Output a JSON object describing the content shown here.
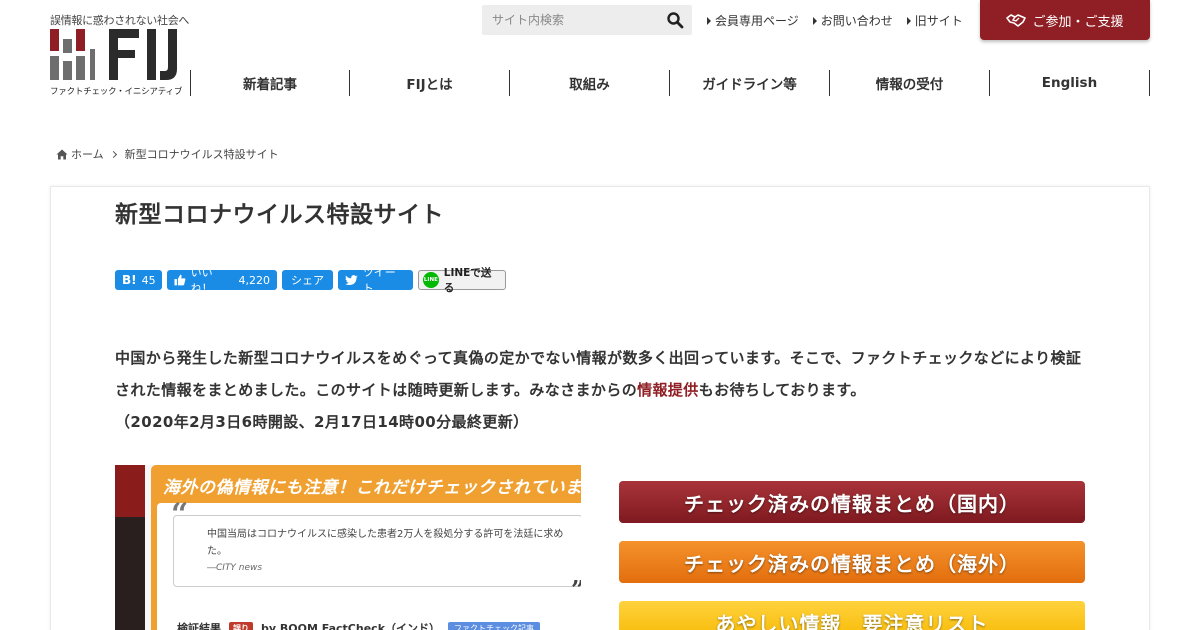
{
  "header": {
    "tagline": "誤情報に惑わされない社会へ",
    "logo_text": "FIJ",
    "logo_caption": "ファクトチェック・イニシアティブ",
    "search": {
      "placeholder": "サイト内検索"
    },
    "top_links": [
      "会員専用ページ",
      "お問い合わせ",
      "旧サイト"
    ],
    "support_label": "ご参加・ご支援",
    "nav": [
      "新着記事",
      "FIJとは",
      "取組み",
      "ガイドライン等",
      "情報の受付",
      "English"
    ],
    "colors": {
      "brand": "#8f1f25",
      "logo_gray": "#6e6e6e"
    }
  },
  "breadcrumb": {
    "home": "ホーム",
    "current": "新型コロナウイルス特設サイト"
  },
  "page": {
    "title": "新型コロナウイルス特設サイト",
    "share": {
      "hatena_label": "B!",
      "hatena_count": "45",
      "fb_like_label": "いいね！",
      "fb_like_count": "4,220",
      "fb_share_label": "シェア",
      "tweet_label": "ツイート",
      "line_label": "LINEで送る",
      "line_icon_text": "LINE"
    },
    "intro": {
      "part1": "中国から発生した新型コロナウイルスをめぐって真偽の定かでない情報が数多く出回っています。そこで、ファクトチェックなどにより検証された情報をまとめました。このサイトは随時更新します。みなさまからの",
      "link": "情報提供",
      "part2": "もお待ちしております。",
      "dates": "（2020年2月3日6時開設、2月17日14時00分最終更新）"
    },
    "image": {
      "heading": "海外の偽情報にも注意！これだけチェックされています",
      "quote": "中国当局はコロナウイルスに感染した患者2万人を殺処分する許可を法廷に求めた。",
      "source": "―CITY news",
      "result_label": "検証結果",
      "verdict": "誤り",
      "checker": "by BOOM FactCheck（インド）",
      "tag": "ファクトチェック記事"
    },
    "buttons": [
      "チェック済みの情報まとめ（国内）",
      "チェック済みの情報まとめ（海外）",
      "あやしい情報　要注意リスト"
    ]
  }
}
